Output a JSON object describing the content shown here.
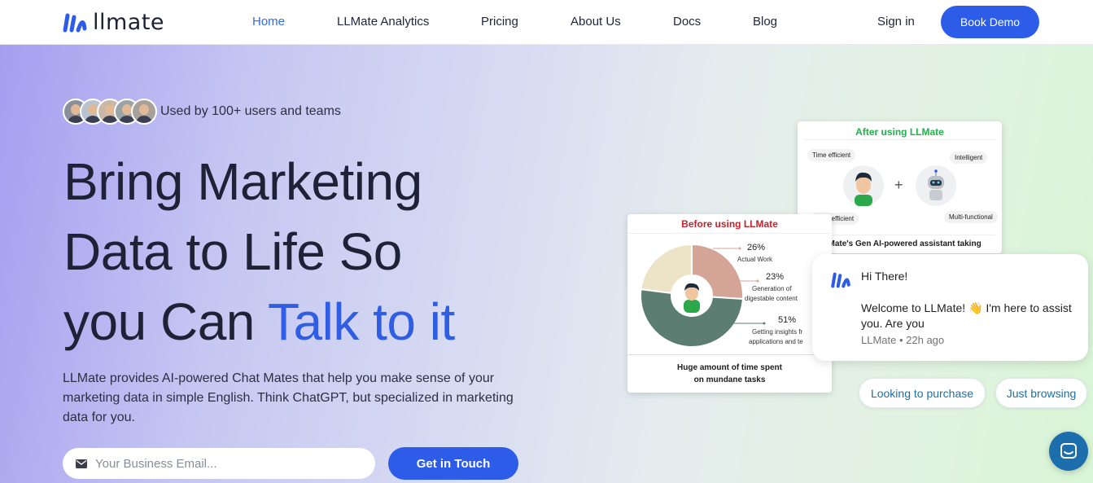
{
  "header": {
    "logo_text": "llmate",
    "nav": [
      {
        "label": "Home",
        "active": true
      },
      {
        "label": "LLMate Analytics"
      },
      {
        "label": "Pricing"
      },
      {
        "label": "About Us"
      },
      {
        "label": "Docs"
      },
      {
        "label": "Blog"
      }
    ],
    "signin_label": "Sign in",
    "book_demo_label": "Book Demo"
  },
  "hero": {
    "social_proof": "Used by 100+ users and teams",
    "headline_line1": "Bring Marketing",
    "headline_line2": "Data to Life So",
    "headline_line3_start": "you Can ",
    "headline_highlight": "Talk to it",
    "description": "LLMate provides AI-powered Chat Mates that help you make sense of your marketing data in simple English. Think ChatGPT, but specialized in marketing data for you.",
    "email_placeholder": "Your Business Email...",
    "cta_label": "Get in Touch"
  },
  "card_after": {
    "title": "After using LLMate",
    "tags": [
      "Time efficient",
      "Intelligent",
      "Cost efficient",
      "Multi-functional"
    ],
    "plus": "+",
    "footer": "LLMate's Gen AI-powered assistant taking"
  },
  "card_before": {
    "title": "Before using LLMate",
    "segments": [
      {
        "pct": "26%",
        "label": "Actual Work",
        "value": 26,
        "color": "#d4a497"
      },
      {
        "pct": "23%",
        "label": "Generation of",
        "label2": "digestable content",
        "value": 23,
        "color": "#ede3c7"
      },
      {
        "pct": "51%",
        "label": "Getting insights fr",
        "label2": "applications and te",
        "value": 51,
        "color": "#5b7d72"
      }
    ],
    "footer_line1": "Huge amount of time spent",
    "footer_line2": "on mundane tasks"
  },
  "chat": {
    "greeting": "Hi There!",
    "message": "Welcome to LLMate! 👋 I'm here to assist you. Are you",
    "meta": "LLMate • 22h ago",
    "replies": [
      "Looking to purchase",
      "Just browsing"
    ]
  },
  "colors": {
    "brand_blue": "#2d5ce8",
    "highlight": "#2f5ee3",
    "after_green": "#22b14c",
    "before_red": "#c0232b",
    "launcher": "#1c6fac"
  }
}
